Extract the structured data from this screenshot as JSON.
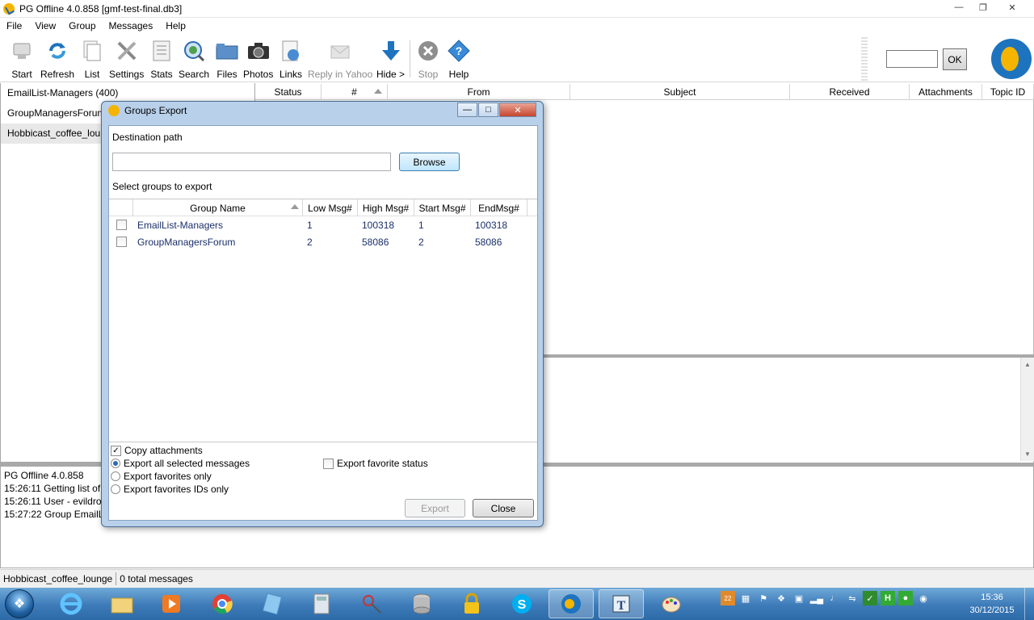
{
  "window": {
    "title": "PG Offline 4.0.858  [gmf-test-final.db3]"
  },
  "menu": [
    "File",
    "View",
    "Group",
    "Messages",
    "Help"
  ],
  "toolbar": {
    "buttons": [
      {
        "label": "Start",
        "icon": "start-icon"
      },
      {
        "label": "Refresh",
        "icon": "refresh-icon"
      },
      {
        "label": "List",
        "icon": "list-icon"
      },
      {
        "label": "Settings",
        "icon": "settings-icon"
      },
      {
        "label": "Stats",
        "icon": "stats-icon"
      },
      {
        "label": "Search",
        "icon": "search-icon"
      },
      {
        "label": "Files",
        "icon": "files-icon"
      },
      {
        "label": "Photos",
        "icon": "camera-icon"
      },
      {
        "label": "Links",
        "icon": "links-icon"
      },
      {
        "label": "Reply in Yahoo",
        "icon": "reply-icon"
      },
      {
        "label": "Hide >",
        "icon": "arrow-down-icon"
      },
      {
        "label": "Stop",
        "icon": "stop-icon"
      },
      {
        "label": "Help",
        "icon": "help-icon"
      }
    ],
    "ok_label": "OK"
  },
  "groups": [
    {
      "name": "EmailList-Managers (400)"
    },
    {
      "name": "GroupManagersForum"
    },
    {
      "name": "Hobbicast_coffee_lounge"
    }
  ],
  "message_columns": [
    "Status",
    "#",
    "From",
    "Subject",
    "Received",
    "Attachments",
    "Topic ID"
  ],
  "log": [
    "PG Offline 4.0.858",
    "15:26:11 Getting list of",
    "15:26:11 User - evildro",
    "15:27:22 Group EmailL"
  ],
  "status": {
    "group": "Hobbicast_coffee_lounge",
    "count": "0 total messages"
  },
  "dialog": {
    "title": "Groups Export",
    "destination_label": "Destination path",
    "destination_value": "",
    "browse_label": "Browse",
    "select_label": "Select groups to export",
    "columns": [
      "Group Name",
      "Low Msg#",
      "High Msg#",
      "Start Msg#",
      "EndMsg#"
    ],
    "rows": [
      {
        "name": "EmailList-Managers",
        "low": "1",
        "high": "100318",
        "start": "1",
        "end": "100318",
        "checked": false
      },
      {
        "name": "GroupManagersForum",
        "low": "2",
        "high": "58086",
        "start": "2",
        "end": "58086",
        "checked": false
      }
    ],
    "copy_attachments_label": "Copy attachments",
    "copy_attachments_checked": true,
    "radio_options": [
      "Export all selected messages",
      "Export favorites only",
      "Export favorites IDs only"
    ],
    "radio_selected": "Export all selected messages",
    "favorite_status_label": "Export favorite status",
    "export_label": "Export",
    "close_label": "Close"
  },
  "taskbar": {
    "clock_time": "15:36",
    "clock_date": "30/12/2015",
    "apps": [
      "internet-explorer-icon",
      "file-explorer-icon",
      "media-player-icon",
      "chrome-icon",
      "notes-icon",
      "calculator-icon",
      "scissors-icon",
      "database-icon",
      "lock-icon",
      "skype-icon",
      "pg-offline-icon",
      "text-editor-icon",
      "paint-icon"
    ]
  }
}
